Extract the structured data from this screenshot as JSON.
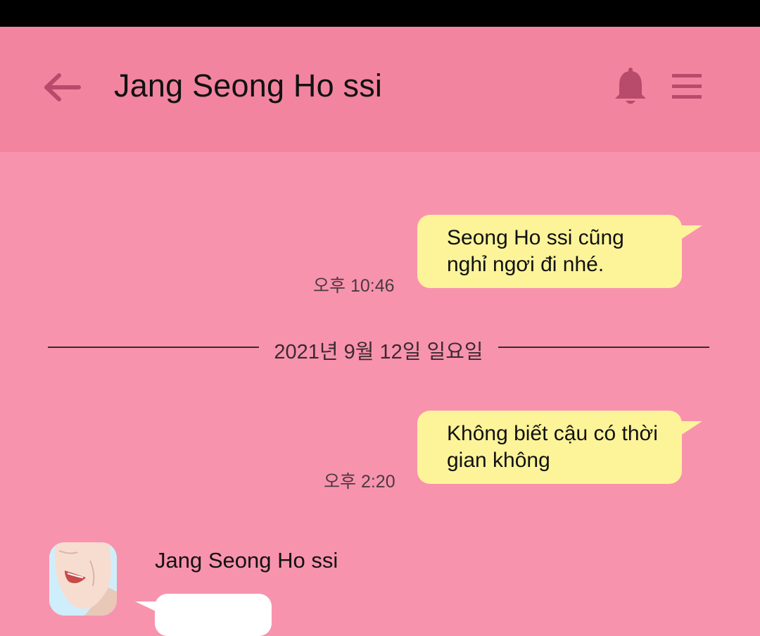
{
  "header": {
    "title": "Jang Seong Ho ssi",
    "back_icon": "arrow-left-icon",
    "bell_icon": "bell-icon",
    "menu_icon": "hamburger-menu-icon"
  },
  "messages": [
    {
      "text_lines": [
        "Seong Ho ssi cũng",
        "nghỉ ngơi đi nhé."
      ],
      "time": "오후 10:46"
    },
    {
      "text_lines": [
        "Không biết cậu có thời",
        "gian không"
      ],
      "time": "오후 2:20"
    }
  ],
  "date_divider": "2021년 9월 12일 일요일",
  "incoming": {
    "sender_name": "Jang Seong Ho ssi"
  },
  "colors": {
    "background": "#f893ae",
    "header": "#f2849f",
    "icon": "#b84a6b",
    "outgoing_bubble": "#fdf49a",
    "incoming_bubble": "#ffffff"
  }
}
